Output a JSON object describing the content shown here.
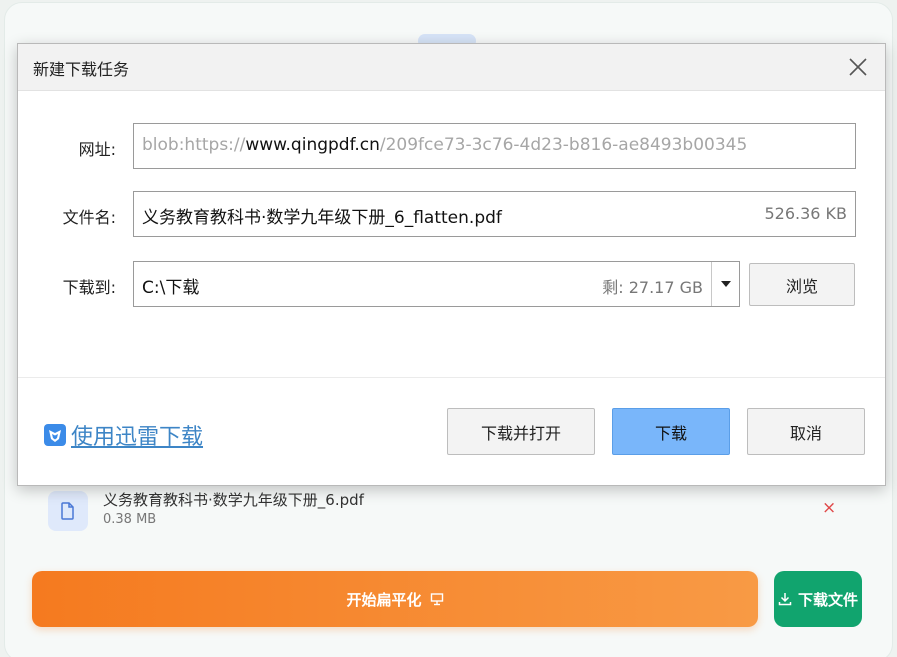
{
  "background": {
    "file": {
      "name": "义务教育教科书·数学九年级下册_6.pdf",
      "size": "0.38 MB",
      "remove": "×"
    },
    "flatten_button": "开始扁平化",
    "download_file_button": "下载文件"
  },
  "dialog": {
    "title": "新建下载任务",
    "url": {
      "label": "网址:",
      "prefix": "blob:https://",
      "domain": "www.qingpdf.cn",
      "suffix": "/209fce73-3c76-4d23-b816-ae8493b00345"
    },
    "filename": {
      "label": "文件名:",
      "value": "义务教育教科书·数学九年级下册_6_flatten.pdf",
      "size": "526.36 KB"
    },
    "saveto": {
      "label": "下载到:",
      "value": "C:\\下载",
      "free_space": "剩: 27.17 GB",
      "browse": "浏览"
    },
    "xunlei_link": "使用迅雷下载",
    "buttons": {
      "download_open": "下载并打开",
      "download": "下载",
      "cancel": "取消"
    }
  },
  "colors": {
    "primary": "#79b6fa",
    "orange": "#f57a1f",
    "green": "#11a46e",
    "link": "#3d85c6"
  }
}
